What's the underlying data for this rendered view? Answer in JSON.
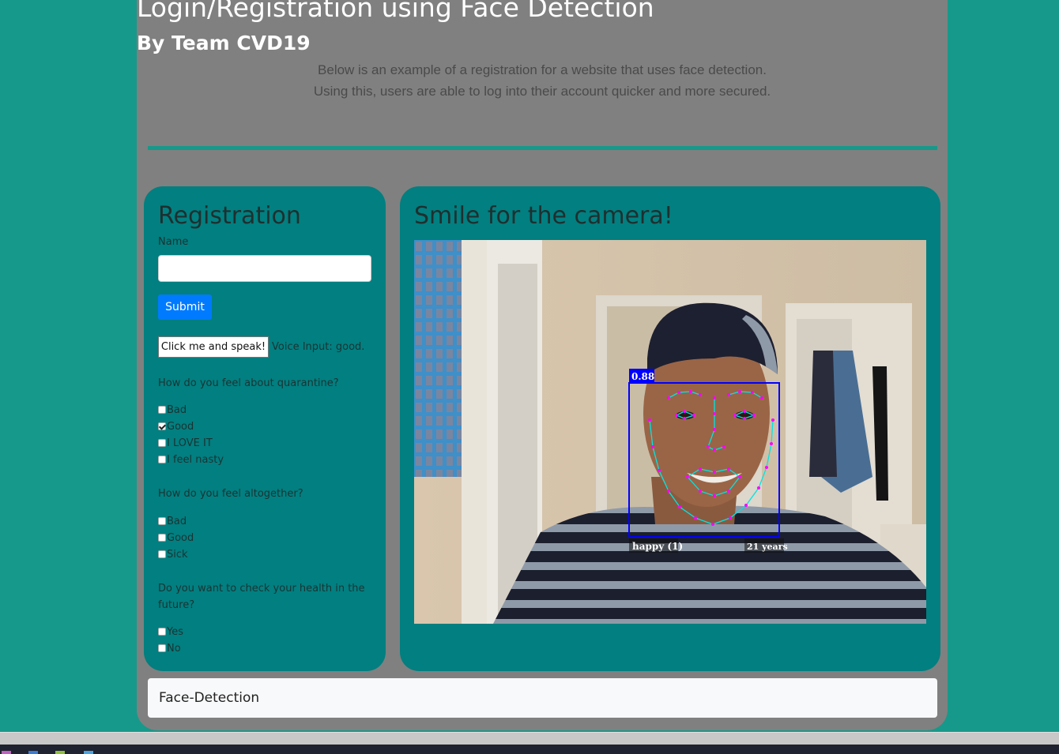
{
  "header": {
    "title": "Login/Registration using Face Detection",
    "subtitle": "By Team CVD19",
    "description_line1": "Below is an example of a registration for a website that uses face detection.",
    "description_line2": "Using this, users are able to log into their account quicker and more secured."
  },
  "registration": {
    "title": "Registration",
    "name_label": "Name",
    "name_value": "",
    "submit_label": "Submit",
    "speak_button": "Click me and speak!",
    "voice_input": "Voice Input: good.",
    "q1": {
      "question": "How do you feel about quarantine?",
      "options": [
        {
          "label": "Bad",
          "checked": false
        },
        {
          "label": " Good",
          "checked": true
        },
        {
          "label": " I LOVE IT",
          "checked": false
        },
        {
          "label": " I feel nasty",
          "checked": false
        }
      ]
    },
    "q2": {
      "question": "How do you feel altogether?",
      "options": [
        {
          "label": "Bad",
          "checked": false
        },
        {
          "label": " Good",
          "checked": false
        },
        {
          "label": "Sick",
          "checked": false
        }
      ]
    },
    "q3": {
      "question_line1": "Do you want to check your health in the",
      "question_line2": "future?",
      "options": [
        {
          "label": "Yes",
          "checked": false
        },
        {
          "label": "No",
          "checked": false
        }
      ]
    }
  },
  "camera": {
    "title": "Smile for the camera!",
    "detection_score": "0.88",
    "expression_label": "happy (1)",
    "age_label": "21 years"
  },
  "footer": {
    "text": "Face-Detection"
  },
  "colors": {
    "background": "#16998a",
    "panel": "#027f80",
    "container": "#808080",
    "submit": "#007bff",
    "detection_box": "#0000ff",
    "landmarks": "#ff00ff",
    "landmark_lines": "#00e5e5"
  }
}
